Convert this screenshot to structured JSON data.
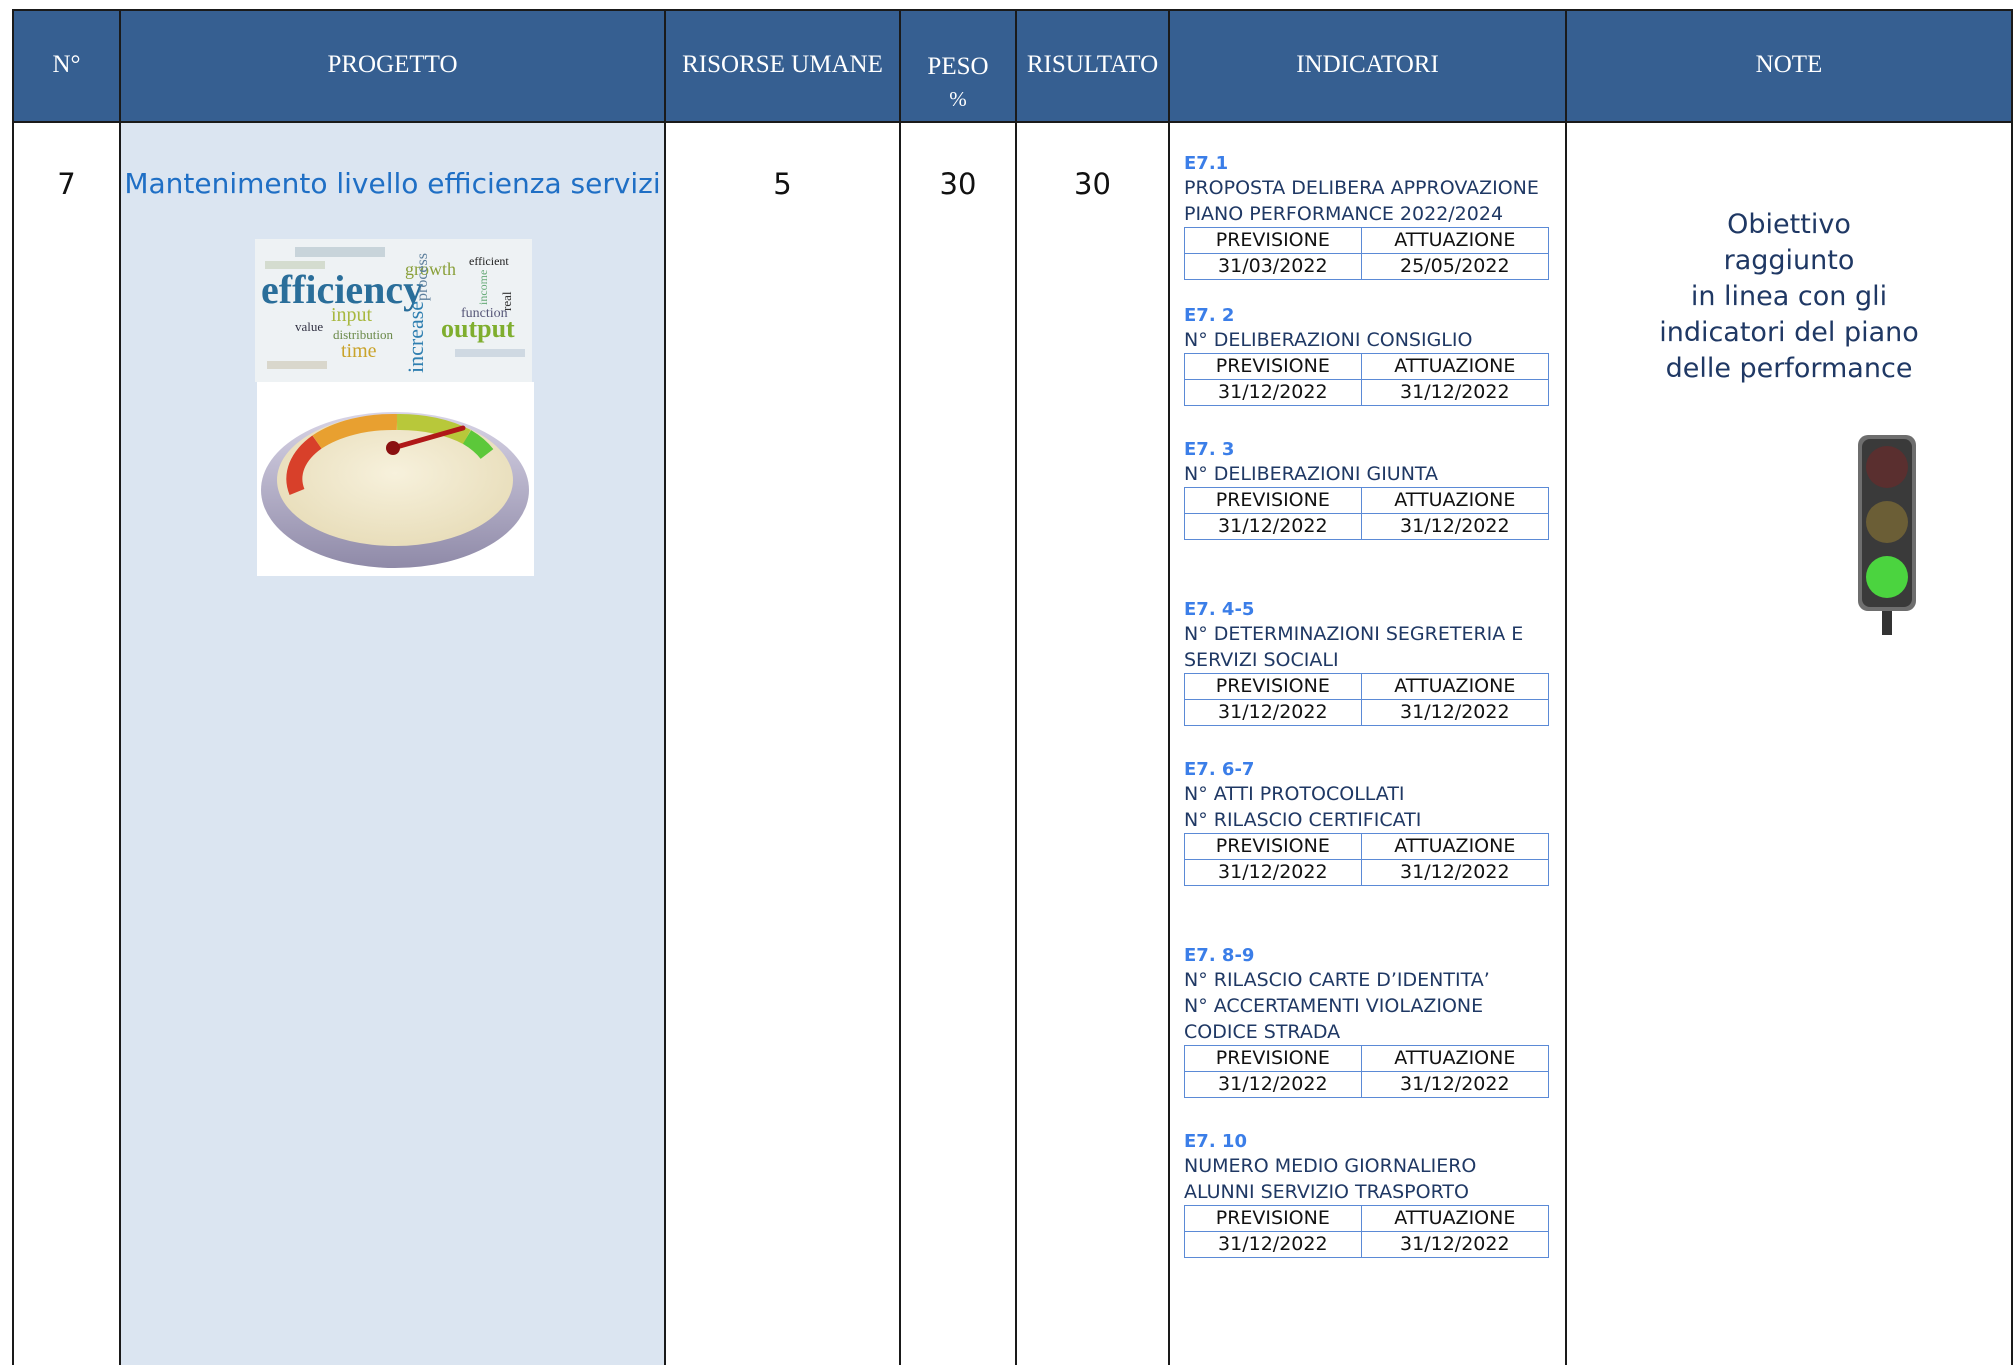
{
  "headers": {
    "num": "N°",
    "progetto": "PROGETTO",
    "risorse": "RISORSE UMANE",
    "peso_line1": "PESO",
    "peso_line2": "%",
    "risultato": "RISULTATO",
    "indicatori": "INDICATORI",
    "note": "NOTE"
  },
  "row": {
    "num": "7",
    "progetto": "Mantenimento livello efficienza servizi",
    "risorse": "5",
    "peso": "30",
    "risultato": "30",
    "note_lines": [
      "Obiettivo",
      "raggiunto",
      "in linea con gli",
      "indicatori del piano",
      "delle performance"
    ]
  },
  "wordcloud_words": [
    "efficiency",
    "growth",
    "input",
    "output",
    "value",
    "distribution",
    "time",
    "increase",
    "function",
    "process",
    "efficient",
    "real",
    "income"
  ],
  "traffic_light": {
    "active": "green",
    "colors": {
      "red": "#5a2f2f",
      "yellow": "#6b5e36",
      "green": "#4bd43f"
    }
  },
  "table_labels": {
    "previsione": "PREVISIONE",
    "attuazione": "ATTUAZIONE"
  },
  "indicators": [
    {
      "code": "E7.1",
      "desc": [
        "PROPOSTA DELIBERA APPROVAZIONE",
        "PIANO PERFORMANCE 2022/2024"
      ],
      "previsione": "31/03/2022",
      "attuazione": "25/05/2022"
    },
    {
      "code": "E7. 2",
      "desc": [
        "N° DELIBERAZIONI CONSIGLIO"
      ],
      "previsione": "31/12/2022",
      "attuazione": "31/12/2022"
    },
    {
      "code": "E7. 3",
      "desc": [
        "N° DELIBERAZIONI GIUNTA"
      ],
      "previsione": "31/12/2022",
      "attuazione": "31/12/2022"
    },
    {
      "code": "E7. 4-5",
      "desc": [
        "N° DETERMINAZIONI SEGRETERIA E",
        "SERVIZI SOCIALI"
      ],
      "previsione": "31/12/2022",
      "attuazione": "31/12/2022"
    },
    {
      "code": "E7. 6-7",
      "desc": [
        "N° ATTI PROTOCOLLATI",
        "N° RILASCIO CERTIFICATI"
      ],
      "previsione": "31/12/2022",
      "attuazione": "31/12/2022"
    },
    {
      "code": "E7. 8-9",
      "desc": [
        "N° RILASCIO CARTE D’IDENTITA’",
        "N° ACCERTAMENTI VIOLAZIONE",
        "CODICE STRADA"
      ],
      "previsione": "31/12/2022",
      "attuazione": "31/12/2022"
    },
    {
      "code": "E7. 10",
      "desc": [
        "NUMERO MEDIO GIORNALIERO",
        "ALUNNI SERVIZIO TRASPORTO"
      ],
      "previsione": "31/12/2022",
      "attuazione": "31/12/2022"
    }
  ]
}
